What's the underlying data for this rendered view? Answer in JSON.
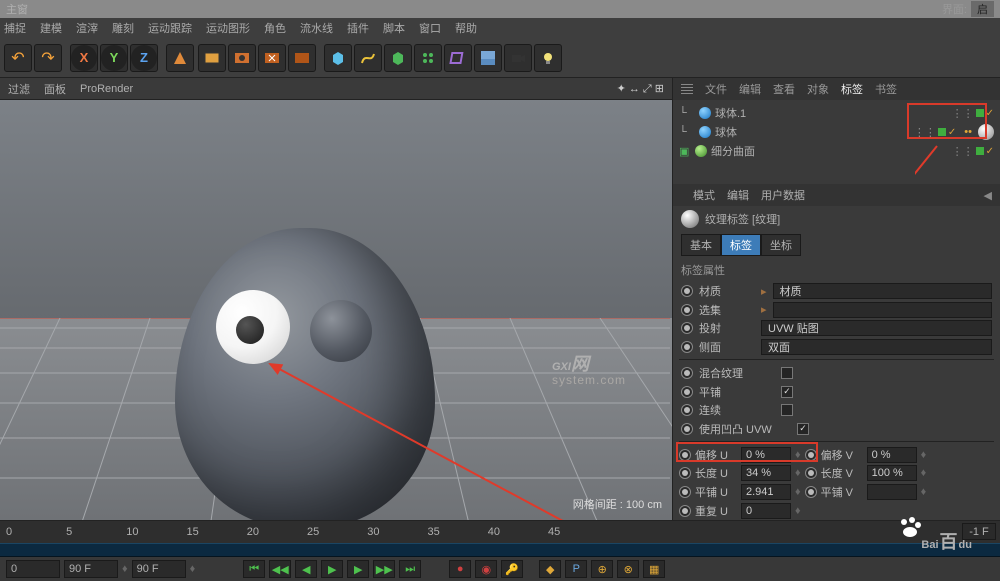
{
  "titlebar": "主窗",
  "menu": [
    "捕捉",
    "建模",
    "渲滓",
    "雕刻",
    "运动跟踪",
    "运动图形",
    "角色",
    "流水线",
    "插件",
    "脚本",
    "窗口",
    "帮助"
  ],
  "vp_tabs": [
    "过滤",
    "面板",
    "ProRender"
  ],
  "vp_footer": "网格间距 : 100 cm",
  "obj_tabs": [
    "文件",
    "编辑",
    "查看",
    "对象",
    "标签",
    "书签"
  ],
  "tree": [
    {
      "name": "球体.1",
      "kind": "sphere",
      "indent": 1
    },
    {
      "name": "球体",
      "kind": "sphere",
      "indent": 1
    },
    {
      "name": "细分曲面",
      "kind": "sub",
      "indent": 0,
      "expand": "+"
    }
  ],
  "mode_tabs": [
    "模式",
    "编辑",
    "用户数据"
  ],
  "tag_title": "纹理标签 [纹理]",
  "subtabs": [
    "基本",
    "标签",
    "坐标"
  ],
  "section": "标签属性",
  "rows": {
    "material": {
      "label": "材质",
      "value": "材质"
    },
    "select": {
      "label": "选集",
      "value": ""
    },
    "projection": {
      "label": "投射",
      "value": "UVW 贴图"
    },
    "side": {
      "label": "侧面",
      "value": "双面"
    }
  },
  "chk": {
    "mix": {
      "label": "混合纹理",
      "on": false
    },
    "tile": {
      "label": "平铺",
      "on": true
    },
    "cont": {
      "label": "连续",
      "on": false
    },
    "bump": {
      "label": "使用凹凸 UVW",
      "on": true
    }
  },
  "uv": {
    "offU": {
      "label": "偏移 U",
      "value": "0 %"
    },
    "offV": {
      "label": "偏移 V",
      "value": "0 %"
    },
    "lenU": {
      "label": "长度 U",
      "value": "34 %"
    },
    "lenV": {
      "label": "长度 V",
      "value": "100 %"
    },
    "tileU": {
      "label": "平铺 U",
      "value": "2.941"
    },
    "tileV": {
      "label": "平铺 V",
      "value": ""
    },
    "repU": {
      "label": "重复 U",
      "value": "0"
    }
  },
  "interface_label": "界面:",
  "interface_value": "启",
  "timeline": {
    "start": "0",
    "end": "90 F",
    "frame": "90 F",
    "rate": "-1 F"
  },
  "watermark": "GXI",
  "watermark_sub": "system.com",
  "watermark_cn": "网",
  "baidu": "Bai",
  "baidu2": "du"
}
